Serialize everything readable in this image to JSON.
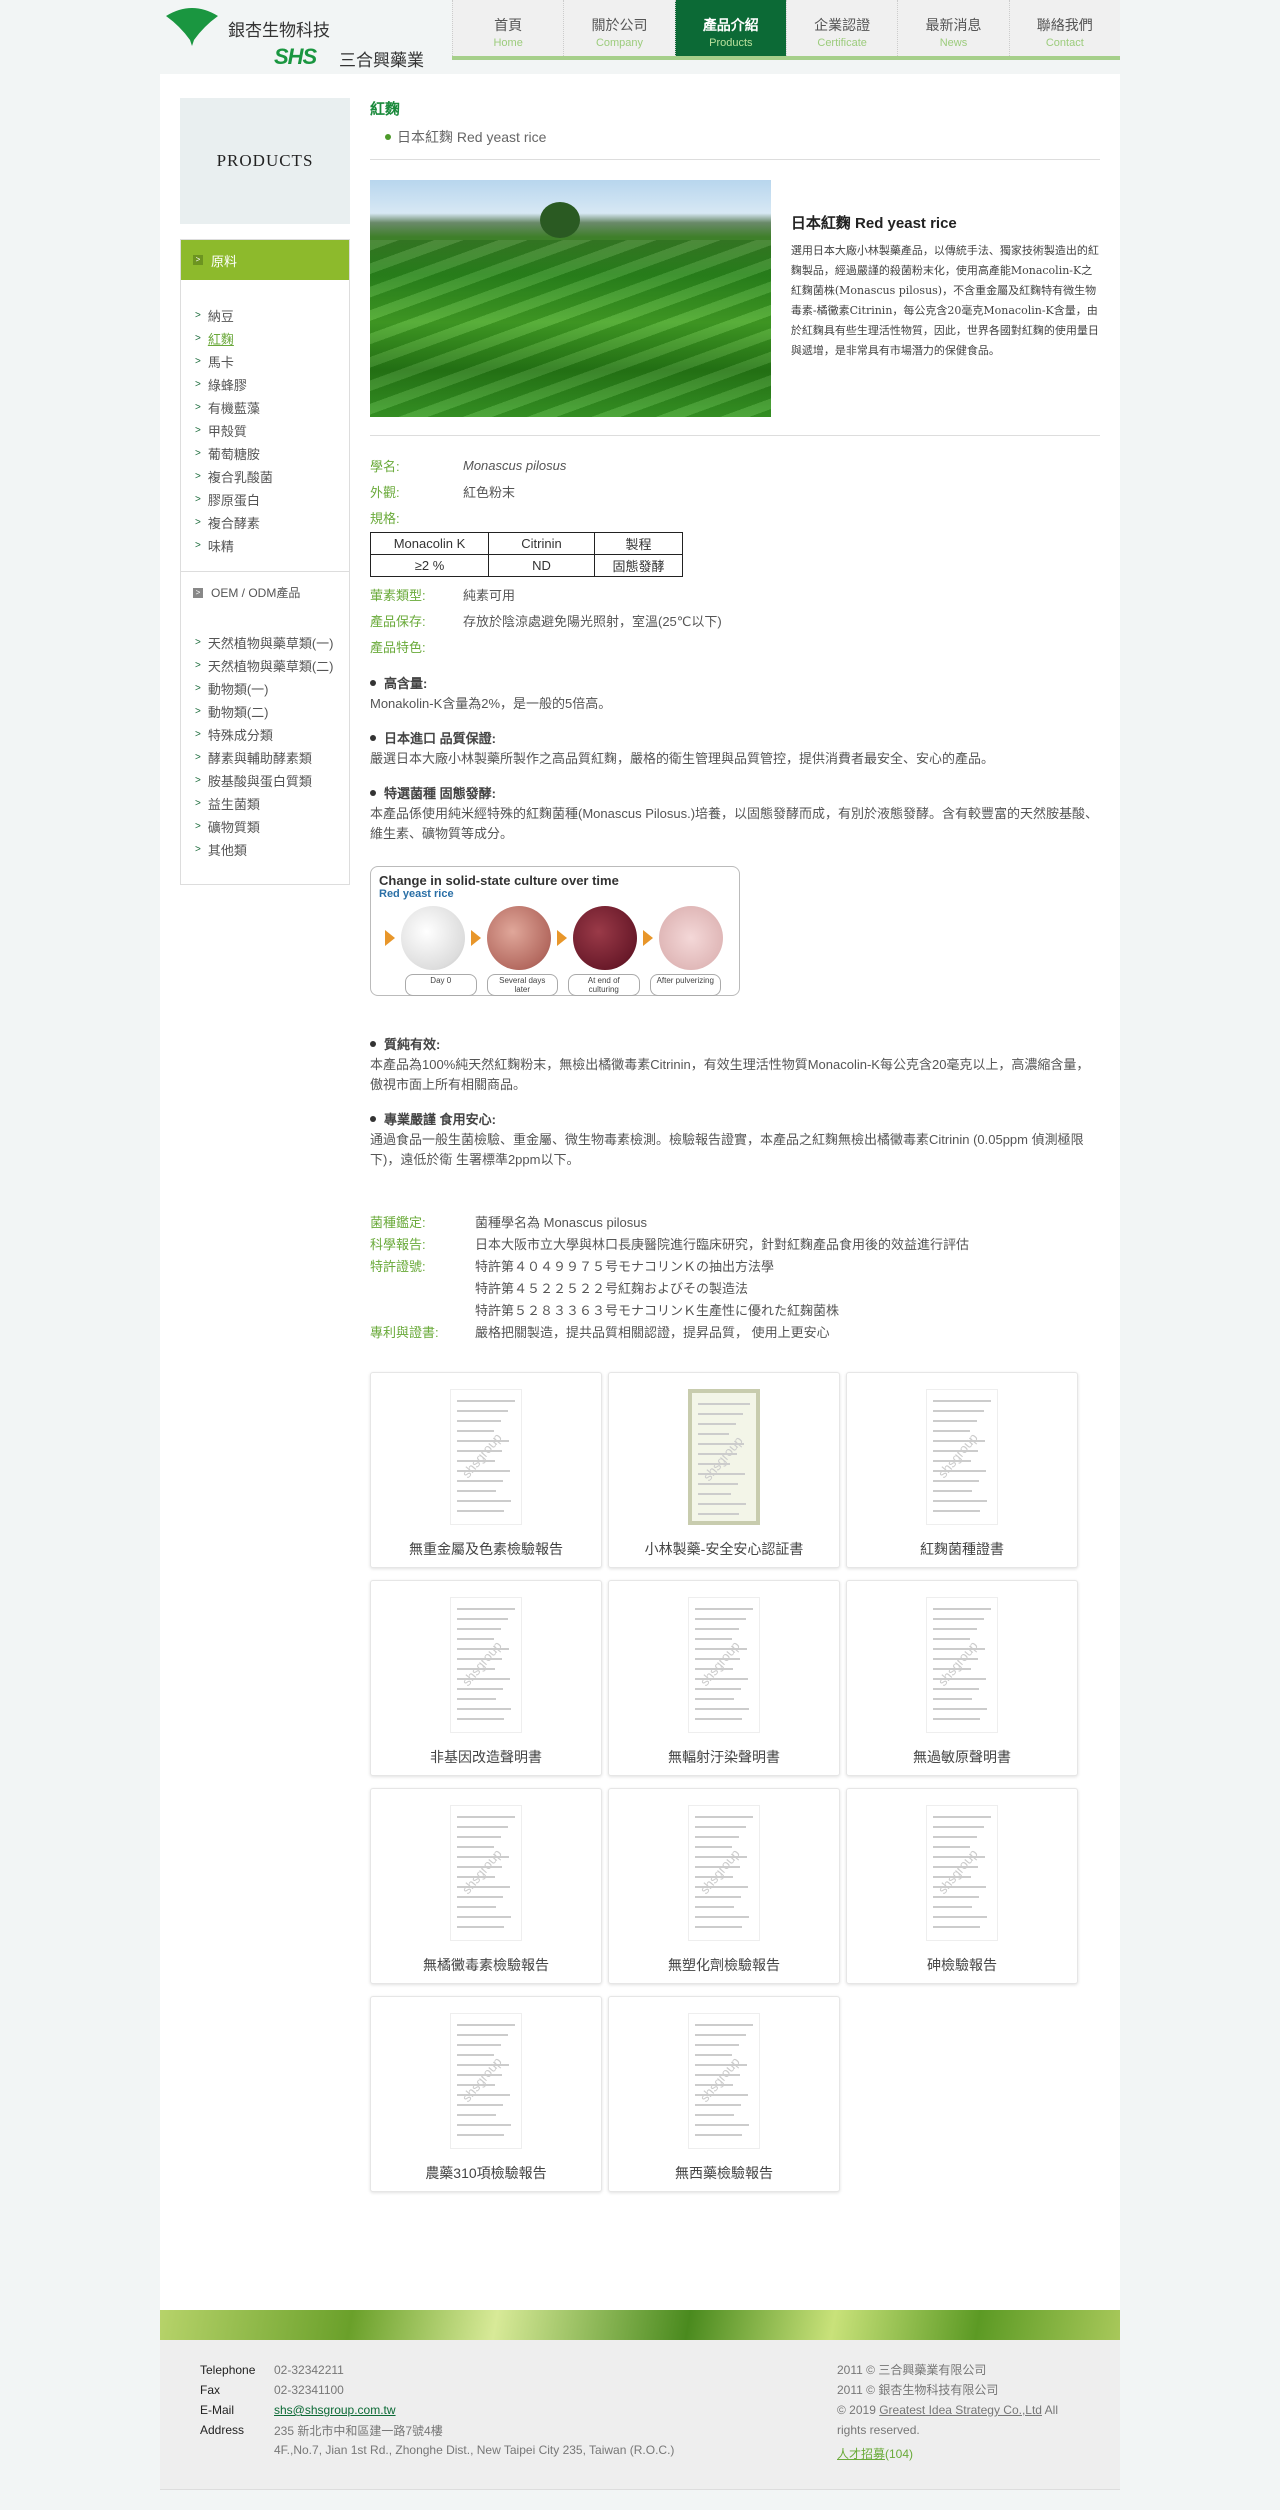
{
  "header": {
    "logo_company": "銀杏生物科技",
    "logo_brand": "SHS",
    "logo_company2": "三合興藥業",
    "nav": [
      {
        "zh": "首頁",
        "en": "Home",
        "active": false
      },
      {
        "zh": "關於公司",
        "en": "Company",
        "active": false
      },
      {
        "zh": "產品介紹",
        "en": "Products",
        "active": true
      },
      {
        "zh": "企業認證",
        "en": "Certificate",
        "active": false
      },
      {
        "zh": "最新消息",
        "en": "News",
        "active": false
      },
      {
        "zh": "聯絡我們",
        "en": "Contact",
        "active": false
      }
    ]
  },
  "sidebar": {
    "banner": "PRODUCTS",
    "raw_head": "原料",
    "raw_items": [
      "納豆",
      "紅麴",
      "馬卡",
      "綠蜂膠",
      "有機藍藻",
      "甲殼質",
      "葡萄糖胺",
      "複合乳酸菌",
      "膠原蛋白",
      "複合酵素",
      "味精"
    ],
    "active_item": "紅麴",
    "oem_head": "OEM / ODM產品",
    "oem_items": [
      "天然植物與藥草類(一)",
      "天然植物與藥草類(二)",
      "動物類(一)",
      "動物類(二)",
      "特殊成分類",
      "酵素與輔助酵素類",
      "胺基酸與蛋白質類",
      "益生菌類",
      "礦物質類",
      "其他類"
    ]
  },
  "main": {
    "title": "紅麴",
    "subtitle": "日本紅麴 Red yeast rice",
    "intro_title": "日本紅麴 Red yeast rice",
    "intro_text": "選用日本大廠小林製藥產品，以傳統手法、獨家技術製造出的紅麴製品，經過嚴謹的殺菌粉末化，使用高產能Monacolin-K之紅麴菌株(Monascus pilosus)，不含重金屬及紅麴特有微生物毒素-橘黴素Citrinin，每公克含20毫克Monacolin-K含量，由於紅麴具有些生理活性物質，因此，世界各國對紅麴的使用量日與遞增，是非常具有市場潛力的保健食品。",
    "spec": {
      "sci_name_label": "學名:",
      "sci_name": "Monascus pilosus",
      "appearance_label": "外觀:",
      "appearance": "紅色粉末",
      "spec_label": "規格:",
      "table_header": [
        "Monacolin K",
        "Citrinin",
        "製程"
      ],
      "table_row": [
        "≥2 %",
        "ND",
        "固態發酵"
      ],
      "veg_label": "葷素類型:",
      "veg": "純素可用",
      "storage_label": "產品保存:",
      "storage": "存放於陰涼處避免陽光照射，室溫(25℃以下)",
      "features_label": "產品特色:"
    },
    "features": [
      {
        "head": "高含量:",
        "body": "Monakolin-K含量為2%，是一般的5倍高。"
      },
      {
        "head": "日本進口 品質保證:",
        "body": "嚴選日本大廠小林製藥所製作之高品質紅麴，嚴格的衛生管理與品質管控，提供消費者最安全、安心的產品。"
      },
      {
        "head": "特選菌種 固態發酵:",
        "body": "本產品係使用純米經特殊的紅麴菌種(Monascus Pilosus.)培養，以固態發酵而成，有別於液態發酵。含有較豐富的天然胺基酸、維生素、礦物質等成分。"
      }
    ],
    "culture": {
      "title": "Change in solid-state culture over time",
      "subtitle": "Red yeast rice",
      "stages": [
        "Day 0",
        "Several days later",
        "At end of culturing",
        "After pulverizing"
      ]
    },
    "features2": [
      {
        "head": "質純有效:",
        "body": "本產品為100%純天然紅麴粉末，無檢出橘黴毒素Citrinin，有效生理活性物質Monacolin-K每公克含20毫克以上，高濃縮含量，傲視市面上所有相關商品。"
      },
      {
        "head": "專業嚴謹 食用安心:",
        "body": "通過食品一般生菌檢驗、重金屬、微生物毒素檢測。檢驗報告證實，本產品之紅麴無檢出橘黴毒素Citrinin (0.05ppm 偵測極限下)，遠低於衛 生署標準2ppm以下。"
      }
    ],
    "info": [
      {
        "label": "菌種鑑定:",
        "value": "菌種學名為 Monascus pilosus"
      },
      {
        "label": "科學報告:",
        "value": "日本大阪市立大學與林口長庚醫院進行臨床研究，針對紅麴產品食用後的效益進行評估"
      },
      {
        "label": "特許證號:",
        "value": "特許第４０４９９７５号モナコリンＫの抽出方法學"
      },
      {
        "label": "",
        "value": "特許第４５２２５２２号紅麹およびその製造法"
      },
      {
        "label": "",
        "value": "特許第５２８３３６３号モナコリンＫ生產性に優れた紅麹菌株"
      },
      {
        "label": "專利與證書:",
        "value": "嚴格把關製造，提共品質相關認證，提昇品質， 使用上更安心"
      }
    ],
    "certificates": [
      "無重金屬及色素檢驗報告",
      "小林製藥-安全安心認証書",
      "紅麴菌種證書",
      "非基因改造聲明書",
      "無輻射汙染聲明書",
      "無過敏原聲明書",
      "無橘黴毒素檢驗報告",
      "無塑化劑檢驗報告",
      "砷檢驗報告",
      "農藥310項檢驗報告",
      "無西藥檢驗報告"
    ],
    "watermark": "shsgroup"
  },
  "footer": {
    "telephone_label": "Telephone",
    "telephone": "02-32342211",
    "fax_label": "Fax",
    "fax": "02-32341100",
    "email_label": "E-Mail",
    "email": "shs@shsgroup.com.tw",
    "address_label": "Address",
    "address_zh": "235 新北市中和區建一路7號4樓",
    "address_en": "4F.,No.7, Jian 1st Rd., Zhonghe Dist., New Taipei City 235, Taiwan (R.O.C.)",
    "copy1": "2011 © 三合興藥業有限公司",
    "copy2": "2011 © 銀杏生物科技有限公司",
    "copy3_prefix": "© 2019 ",
    "copy3_link": "Greatest Idea Strategy Co.,Ltd",
    "copy3_suffix": " All rights reserved.",
    "jobs_link": "人才招募",
    "jobs_count": "(104)"
  }
}
